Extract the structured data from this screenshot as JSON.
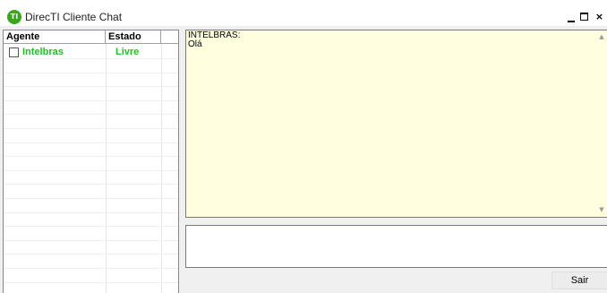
{
  "window": {
    "title": "DirecTI Cliente Chat",
    "icon_text": "TI",
    "minimize_label": "_",
    "close_label": "×"
  },
  "agent_list": {
    "columns": [
      "Agente",
      "Estado"
    ],
    "rows": [
      {
        "agent": "Intelbras",
        "status": "Livre",
        "checked": false
      }
    ],
    "status_color": "#20c020"
  },
  "chat": {
    "sender": "INTELBRAS:",
    "message": "Olá",
    "background": "#ffffe0"
  },
  "input": {
    "value": ""
  },
  "buttons": {
    "exit_label": "Sair"
  }
}
